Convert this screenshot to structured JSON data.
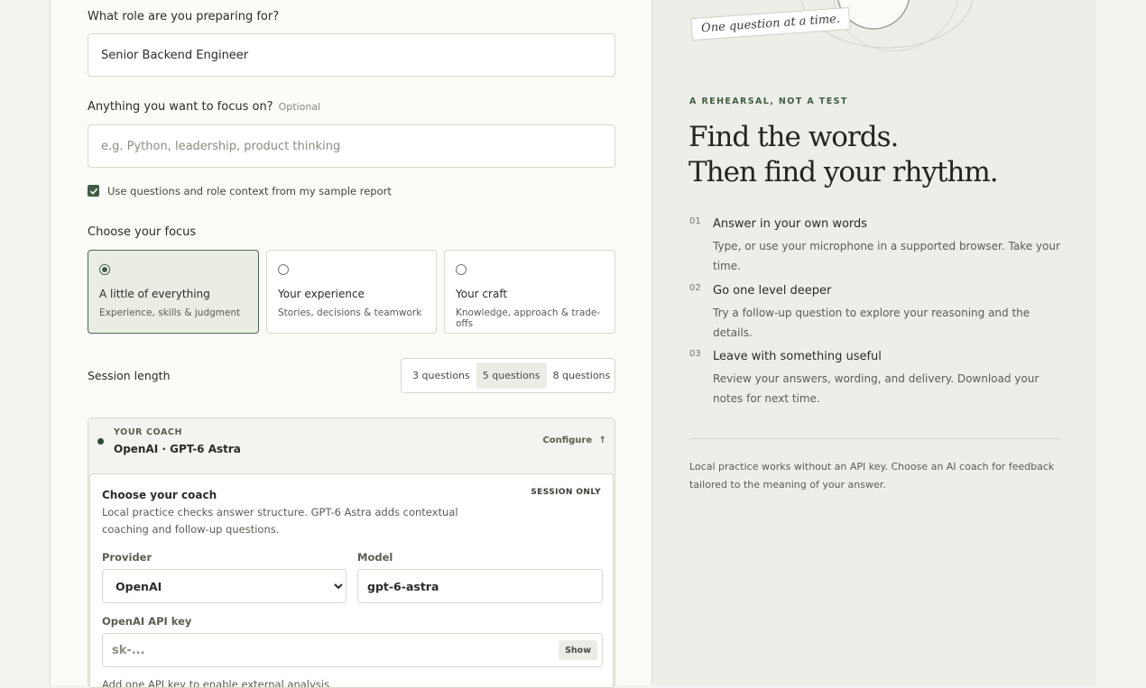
{
  "form": {
    "role_label": "What role are you preparing for?",
    "role_value": "Senior Backend Engineer",
    "focus_label": "Anything you want to focus on?",
    "focus_optional": "Optional",
    "focus_placeholder": "e.g. Python, leadership, product thinking",
    "sample_checkbox_label": "Use questions and role context from my sample report",
    "sample_checked": true,
    "choose_focus_label": "Choose your focus",
    "focus_options": [
      {
        "title": "A little of everything",
        "subtitle": "Experience, skills & judgment",
        "selected": true
      },
      {
        "title": "Your experience",
        "subtitle": "Stories, decisions & teamwork",
        "selected": false
      },
      {
        "title": "Your craft",
        "subtitle": "Knowledge, approach & trade-offs",
        "selected": false
      }
    ],
    "session_length_label": "Session length",
    "session_options": [
      "3 questions",
      "5 questions",
      "8 questions"
    ],
    "session_selected": "5 questions"
  },
  "coach": {
    "header_caption": "YOUR COACH",
    "header_value": "OpenAI · GPT-6 Astra",
    "configure_label": "Configure",
    "configure_arrow": "↑",
    "panel_title": "Choose your coach",
    "session_only": "SESSION ONLY",
    "panel_desc_1": "Local practice checks answer structure. GPT-6 Astra adds contextual",
    "panel_desc_2": "coaching and follow-up questions.",
    "provider_label": "Provider",
    "provider_value": "OpenAI",
    "model_label": "Model",
    "model_value": "gpt-6-astra",
    "api_key_label": "OpenAI API key",
    "api_key_placeholder": "sk-...",
    "show_label": "Show",
    "api_hint": "Add one API key to enable external analysis"
  },
  "aside": {
    "note_tag": "One question at a time.",
    "eyebrow": "A REHEARSAL, NOT A TEST",
    "headline_1": "Find the words.",
    "headline_2": "Then find your rhythm.",
    "steps": [
      {
        "num": "01",
        "title": "Answer in your own words",
        "desc": "Type, or use your microphone in a supported browser. Take your time."
      },
      {
        "num": "02",
        "title": "Go one level deeper",
        "desc": "Try a follow-up question to explore your reasoning and the details."
      },
      {
        "num": "03",
        "title": "Leave with something useful",
        "desc": "Review your answers, wording, and delivery. Download your notes for next time."
      }
    ],
    "footer_1": "Local practice works without an API key. Choose an AI coach for feedback",
    "footer_2": "tailored to the meaning of your answer."
  },
  "colors": {
    "accent": "#3f5e45",
    "selected_card_bg": "#e9ede4",
    "aside_bg": "#eeeee9"
  }
}
